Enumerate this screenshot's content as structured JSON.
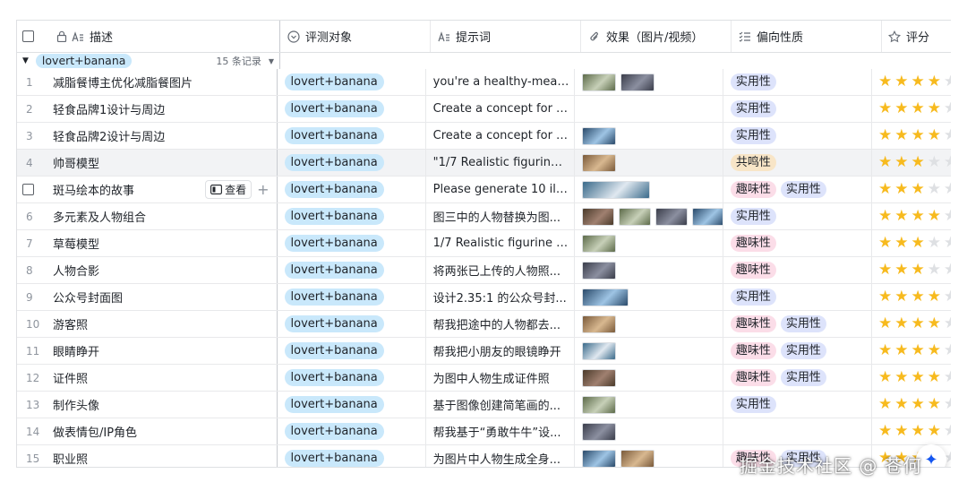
{
  "header": {
    "columns": [
      {
        "label": "描述",
        "icon": "text-icon"
      },
      {
        "label": "评测对象",
        "icon": "option-icon"
      },
      {
        "label": "提示词",
        "icon": "text-icon"
      },
      {
        "label": "效果（图片/视频）",
        "icon": "attachment-icon"
      },
      {
        "label": "偏向性质",
        "icon": "list-icon"
      },
      {
        "label": "评分",
        "icon": "star-icon"
      }
    ]
  },
  "group": {
    "label": "lovert+banana",
    "count": "15 条记录"
  },
  "hover_actions": {
    "view_label": "查看"
  },
  "colors": {
    "star": "#f7ba1e",
    "target_tag": "#c9e8fb",
    "practical_tag": "#dde3fb",
    "fun_tag": "#fbdde8",
    "resonance_tag": "#f8e5c7"
  },
  "rows": [
    {
      "num": "1",
      "desc": "减脂餐博主优化减脂餐图片",
      "target": "lovert+banana",
      "prompt": "you're a healthy-meal c...",
      "thumbs": 2,
      "tags": [
        "实用性"
      ],
      "rating": 4
    },
    {
      "num": "2",
      "desc": "轻食品牌1设计与周边",
      "target": "lovert+banana",
      "prompt": "Create a concept for a l...",
      "thumbs": 0,
      "tags": [
        "实用性"
      ],
      "rating": 4
    },
    {
      "num": "3",
      "desc": "轻食品牌2设计与周边",
      "target": "lovert+banana",
      "prompt": "Create a concept for a l...",
      "thumbs": 1,
      "tags": [
        "实用性"
      ],
      "rating": 4
    },
    {
      "num": "4",
      "desc": "帅哥模型",
      "target": "lovert+banana",
      "prompt": "\"1/7 Realistic figurine o...",
      "thumbs": 1,
      "tags": [
        "共鸣性"
      ],
      "rating": 3
    },
    {
      "num": "",
      "desc": "斑马绘本的故事",
      "target": "lovert+banana",
      "prompt": "Please generate 10 illus...",
      "thumbs": 1,
      "tags": [
        "趣味性",
        "实用性"
      ],
      "rating": 3
    },
    {
      "num": "6",
      "desc": "多元素及人物组合",
      "target": "lovert+banana",
      "prompt": "图三中的人物替换为图...",
      "thumbs": 4,
      "tags": [
        "实用性"
      ],
      "rating": 4
    },
    {
      "num": "7",
      "desc": "草莓模型",
      "target": "lovert+banana",
      "prompt": "1/7 Realistic figurine of ...",
      "thumbs": 1,
      "tags": [
        "趣味性"
      ],
      "rating": 3
    },
    {
      "num": "8",
      "desc": "人物合影",
      "target": "lovert+banana",
      "prompt": "将两张已上传的人物照...",
      "thumbs": 1,
      "tags": [
        "趣味性"
      ],
      "rating": 3
    },
    {
      "num": "9",
      "desc": "公众号封面图",
      "target": "lovert+banana",
      "prompt": "设计2.35:1 的公众号封...",
      "thumbs": 1,
      "tags": [
        "实用性"
      ],
      "rating": 4
    },
    {
      "num": "10",
      "desc": "游客照",
      "target": "lovert+banana",
      "prompt": "帮我把途中的人物都去...",
      "thumbs": 1,
      "tags": [
        "趣味性",
        "实用性"
      ],
      "rating": 4
    },
    {
      "num": "11",
      "desc": "眼睛睁开",
      "target": "lovert+banana",
      "prompt": "帮我把小朋友的眼镜睁开",
      "thumbs": 1,
      "tags": [
        "趣味性",
        "实用性"
      ],
      "rating": 4
    },
    {
      "num": "12",
      "desc": "证件照",
      "target": "lovert+banana",
      "prompt": "为图中人物生成证件照",
      "thumbs": 1,
      "tags": [
        "趣味性",
        "实用性"
      ],
      "rating": 4
    },
    {
      "num": "13",
      "desc": "制作头像",
      "target": "lovert+banana",
      "prompt": "基于图像创建简笔画的...",
      "thumbs": 1,
      "tags": [
        "实用性"
      ],
      "rating": 4
    },
    {
      "num": "14",
      "desc": "做表情包/IP角色",
      "target": "lovert+banana",
      "prompt": "帮我基于“勇敢牛牛”设...",
      "thumbs": 1,
      "tags": [],
      "rating": 4
    },
    {
      "num": "15",
      "desc": "职业照",
      "target": "lovert+banana",
      "prompt": "为图片中人物生成全身...",
      "thumbs": 2,
      "tags": [
        "趣味性",
        "实用性"
      ],
      "rating": 4
    }
  ],
  "watermark": "掘金技术社区 @ 苍何"
}
